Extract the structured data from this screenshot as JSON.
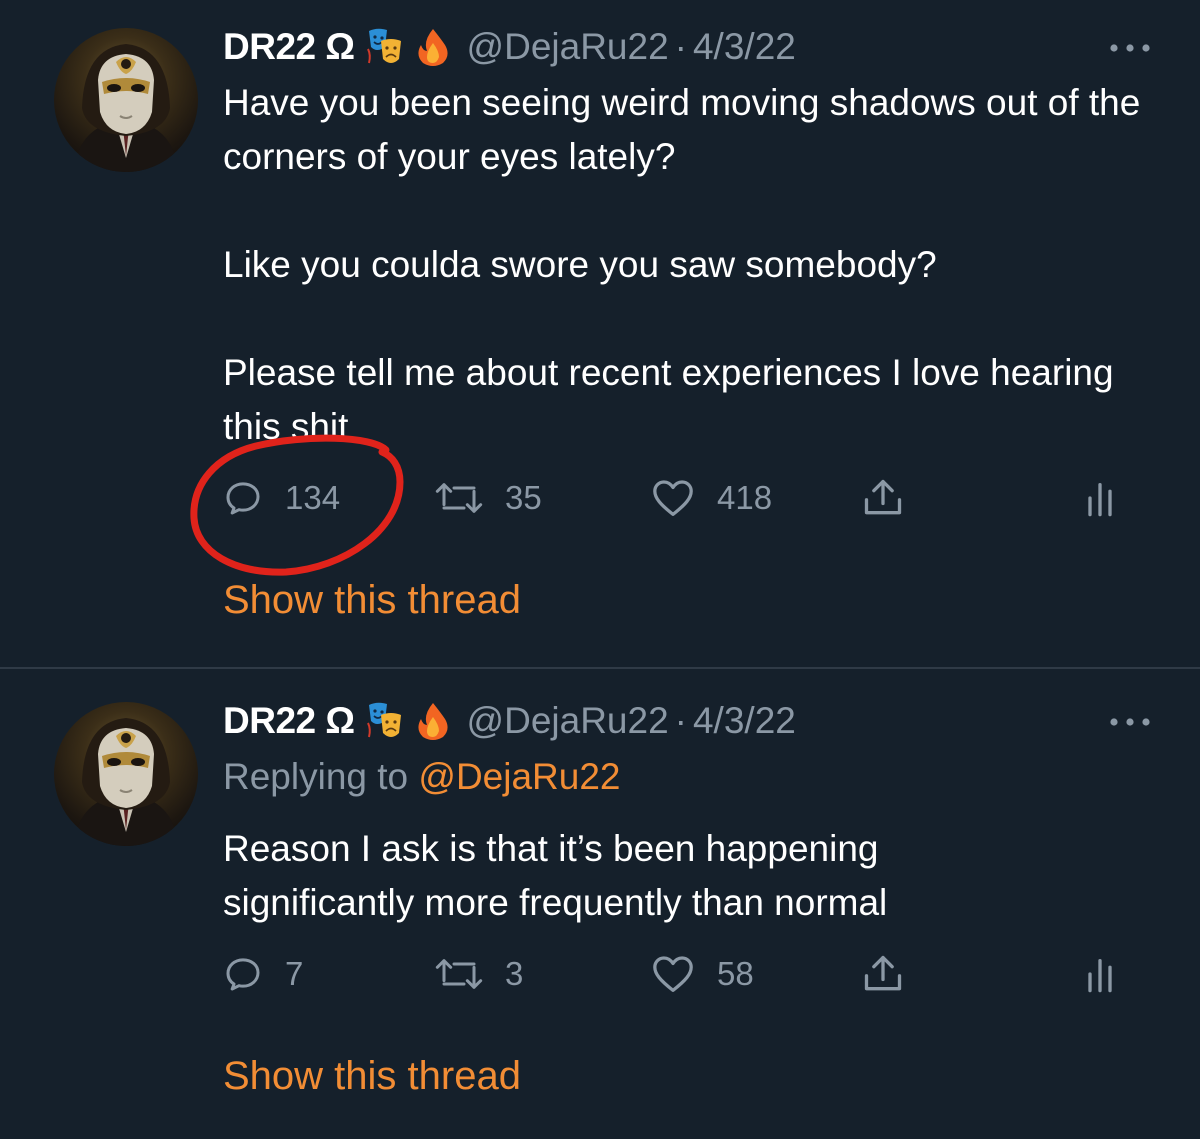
{
  "colors": {
    "background": "#15202b",
    "text_primary": "#ffffff",
    "text_secondary": "#8b98a5",
    "accent": "#f28d35",
    "annotation": "#e0231b"
  },
  "tweets": [
    {
      "name": "DR22 Ω",
      "emojis": [
        "performing-arts-icon",
        "fire-icon"
      ],
      "handle": "@DejaRu22",
      "separator": "·",
      "date": "4/3/22",
      "replying_label": "",
      "replying_handle": "",
      "paragraphs": [
        "Have you been seeing weird moving shadows out of the corners of your eyes lately?",
        "Like you coulda swore you saw somebody?",
        "Please tell me about recent experiences I love hearing this shit"
      ],
      "replies": "134",
      "retweets": "35",
      "likes": "418",
      "thread_link": "Show this thread"
    },
    {
      "name": "DR22 Ω",
      "emojis": [
        "performing-arts-icon",
        "fire-icon"
      ],
      "handle": "@DejaRu22",
      "separator": "·",
      "date": "4/3/22",
      "replying_label": "Replying to",
      "replying_handle": "@DejaRu22",
      "paragraphs": [
        "Reason I ask is that it’s been happening significantly more frequently than normal"
      ],
      "replies": "7",
      "retweets": "3",
      "likes": "58",
      "thread_link": "Show this thread"
    }
  ]
}
